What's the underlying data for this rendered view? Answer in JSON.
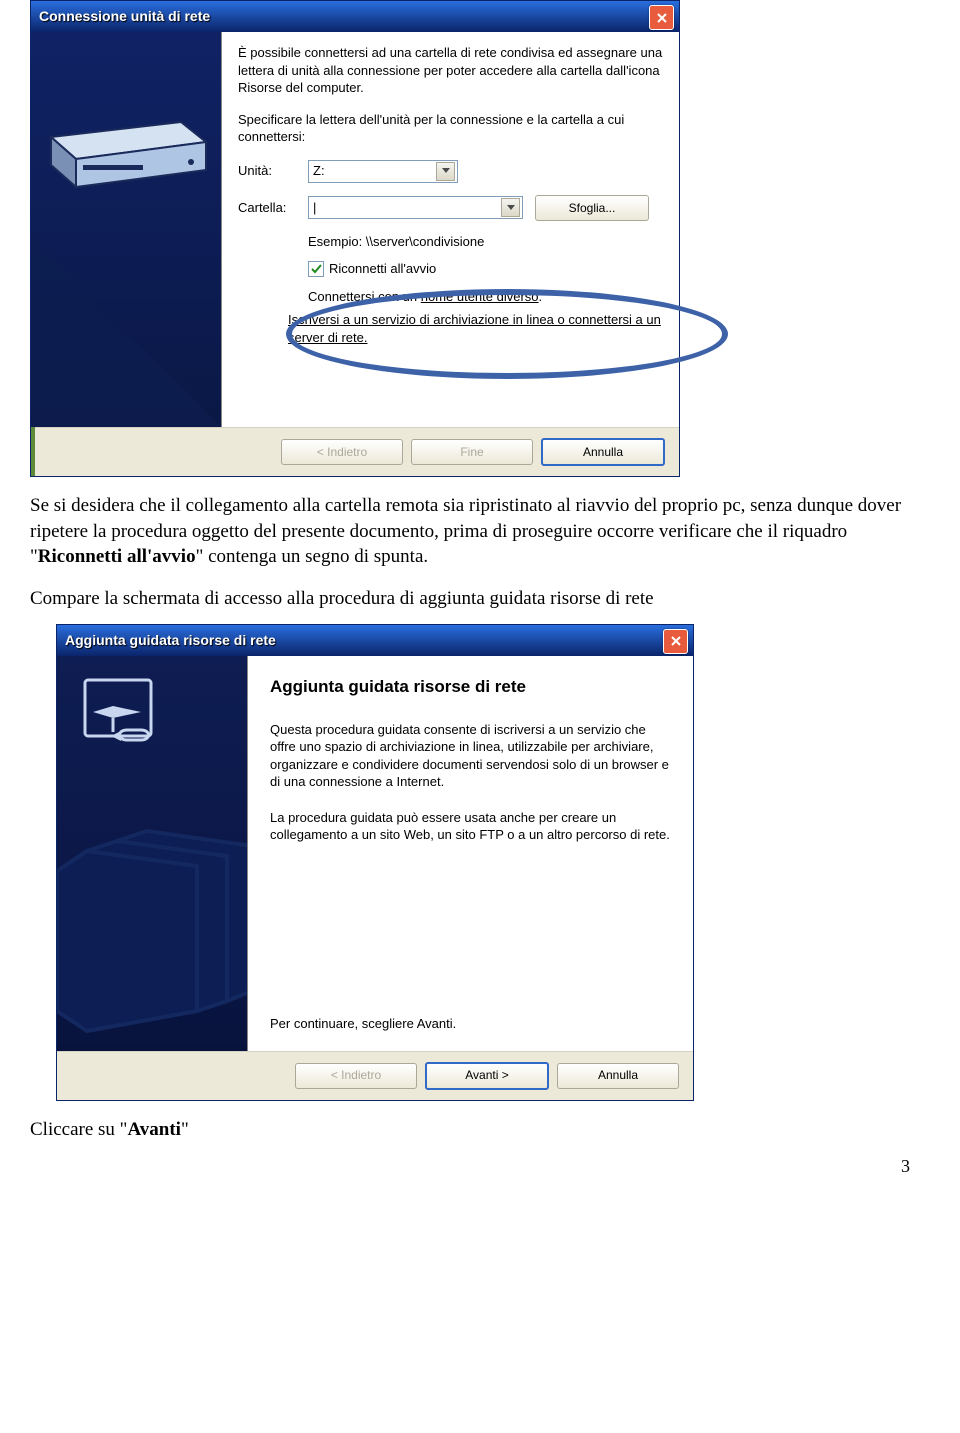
{
  "dialog1": {
    "title": "Connessione unità di rete",
    "intro": "È possibile connettersi ad una cartella di rete condivisa ed assegnare una lettera di unità alla connessione per poter accedere alla cartella dall'icona Risorse del computer.",
    "specify": "Specificare la lettera dell'unità per la connessione e la cartella a cui connettersi:",
    "drive_label": "Unità:",
    "drive_value": "Z:",
    "folder_label": "Cartella:",
    "folder_value": "|",
    "browse_button": "Sfoglia...",
    "example": "Esempio: \\\\server\\condivisione",
    "reconnect": "Riconnetti all'avvio",
    "alt_user_prefix": "Connettersi con un ",
    "alt_user_link": "nome utente diverso",
    "subscribe": "Iscriversi a un servizio di archiviazione in linea o connettersi a un server di rete.",
    "back_button": "< Indietro",
    "finish_button": "Fine",
    "cancel_button": "Annulla"
  },
  "para1_a": "Se si desidera che il collegamento alla cartella remota sia ripristinato al riavvio del proprio pc, senza dunque dover ripetere la procedura oggetto del presente documento, prima di proseguire occorre verificare che il riquadro \"",
  "para1_b": "Riconnetti all'avvio",
  "para1_c": "\" contenga un segno di spunta.",
  "para2": "Compare la schermata di accesso alla procedura di aggiunta guidata risorse di rete",
  "dialog2": {
    "title": "Aggiunta guidata risorse di rete",
    "heading": "Aggiunta guidata risorse di rete",
    "text1": "Questa procedura guidata consente di iscriversi a un servizio che offre uno spazio di archiviazione in linea, utilizzabile per archiviare, organizzare e condividere documenti servendosi solo di un browser e di una connessione a Internet.",
    "text2": "La procedura guidata può essere usata anche per creare un collegamento a un sito Web, un sito FTP o a un altro percorso di rete.",
    "continue": "Per continuare, scegliere Avanti.",
    "back_button": "< Indietro",
    "next_button": "Avanti >",
    "cancel_button": "Annulla"
  },
  "para3_a": "Cliccare su \"",
  "para3_b": "Avanti",
  "para3_c": "\"",
  "page_number": "3"
}
